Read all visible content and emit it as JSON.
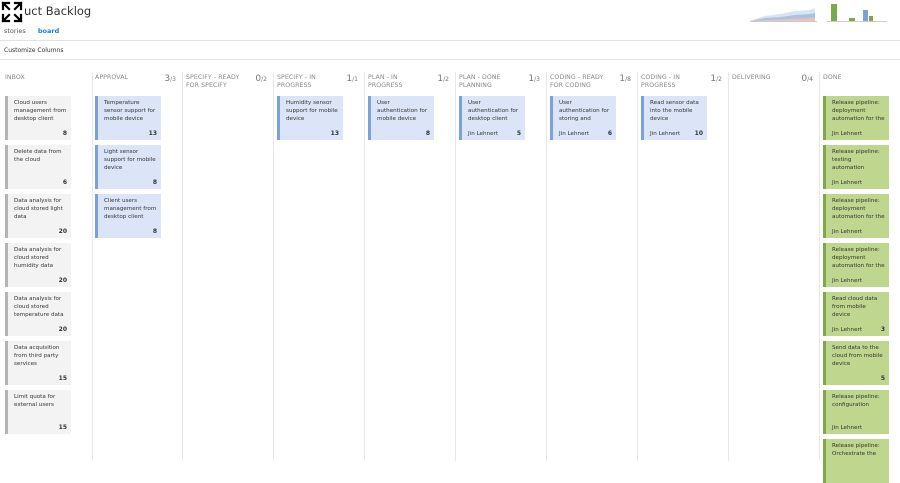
{
  "header": {
    "title": "uct Backlog",
    "tabs": [
      {
        "label": "stories",
        "active": false
      },
      {
        "label": "board",
        "active": true
      }
    ],
    "customize_label": "Customize Columns"
  },
  "colors": {
    "card_default": "#f3f3f3",
    "card_blue": "#dbe5f7",
    "card_green": "#bfd68e",
    "accent": "#1e7cd1"
  },
  "columns": [
    {
      "name": "INBOX",
      "count": "",
      "limit": "",
      "cards": [
        {
          "title": "Cloud users management from desktop client",
          "points": "8",
          "color": "default"
        },
        {
          "title": "Delete data from the cloud",
          "points": "6",
          "color": "default"
        },
        {
          "title": "Data analysis for cloud stored light data",
          "points": "20",
          "color": "default"
        },
        {
          "title": "Data analysis for cloud stored humidity data",
          "points": "20",
          "color": "default"
        },
        {
          "title": "Data analysis for cloud stored temperature data",
          "points": "20",
          "color": "default"
        },
        {
          "title": "Data acquisition from third party services",
          "points": "15",
          "color": "default"
        },
        {
          "title": "Limit quota for external users",
          "points": "15",
          "color": "default"
        }
      ]
    },
    {
      "name": "APPROVAL",
      "count": "3",
      "limit": "/3",
      "cards": [
        {
          "title": "Temperature sensor support for mobile device",
          "points": "13",
          "color": "blue"
        },
        {
          "title": "Light sensor support for mobile device",
          "points": "8",
          "color": "blue"
        },
        {
          "title": "Client users management from desktop client",
          "points": "8",
          "color": "blue"
        }
      ]
    },
    {
      "name": "SPECIFY - READY FOR SPECIFY",
      "count": "0",
      "limit": "/2",
      "cards": []
    },
    {
      "name": "SPECIFY - IN PROGRESS",
      "count": "1",
      "limit": "/1",
      "cards": [
        {
          "title": "Humidity sensor support for mobile device",
          "points": "13",
          "color": "blue"
        }
      ]
    },
    {
      "name": "PLAN - IN PROGRESS",
      "count": "1",
      "limit": "/2",
      "cards": [
        {
          "title": "User authentication for mobile device",
          "points": "8",
          "color": "blue"
        }
      ]
    },
    {
      "name": "PLAN - DONE PLANNING",
      "count": "1",
      "limit": "/3",
      "cards": [
        {
          "title": "User authentication for desktop client",
          "assignee": "Jin Lehnert",
          "points": "5",
          "color": "blue"
        }
      ]
    },
    {
      "name": "CODING - READY FOR CODING",
      "count": "1",
      "limit": "/8",
      "cards": [
        {
          "title": "User authentication for storing and reading data in the",
          "assignee": "Jin Lehnert",
          "points": "6",
          "color": "blue"
        }
      ]
    },
    {
      "name": "CODING - IN PROGRESS",
      "count": "1",
      "limit": "/2",
      "cards": [
        {
          "title": "Read sensor data into the mobile device",
          "assignee": "Jin Lehnert",
          "points": "10",
          "color": "blue"
        }
      ]
    },
    {
      "name": "DELIVERING",
      "count": "0",
      "limit": "/4",
      "cards": []
    },
    {
      "name": "DONE",
      "count": "",
      "limit": "",
      "cards": [
        {
          "title": "Release pipeline: deployment automation for the",
          "assignee": "Jin Lehnert",
          "points": "",
          "color": "green"
        },
        {
          "title": "Release pipeline: testing automation",
          "assignee": "Jin Lehnert",
          "points": "",
          "color": "green"
        },
        {
          "title": "Release pipeline: deployment automation for the",
          "assignee": "Jin Lehnert",
          "points": "",
          "color": "green"
        },
        {
          "title": "Release pipeline: deployment automation for the",
          "assignee": "Jin Lehnert",
          "points": "",
          "color": "green"
        },
        {
          "title": "Read cloud data from mobile device",
          "assignee": "Jin Lehnert",
          "points": "3",
          "color": "green"
        },
        {
          "title": "Send data to the cloud from mobile device",
          "points": "5",
          "color": "green"
        },
        {
          "title": "Release pipeline: configuration",
          "assignee": "Jin Lehnert",
          "points": "",
          "color": "green"
        },
        {
          "title": "Release pipeline: Orchestrate the",
          "points": "",
          "color": "green"
        }
      ]
    }
  ]
}
